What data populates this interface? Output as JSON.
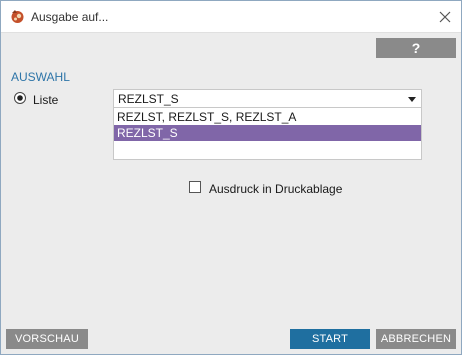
{
  "window": {
    "title": "Ausgabe auf..."
  },
  "toolbar": {
    "help_label": "?"
  },
  "selection": {
    "section_label": "AUSWAHL",
    "radio_label": "Liste",
    "radio_checked": true,
    "select": {
      "value": "REZLST_S",
      "options": [
        "REZLST, REZLST_S, REZLST_A",
        "REZLST_S"
      ],
      "highlighted_index": 1
    }
  },
  "options": {
    "print_tray_label": "Ausdruck in Druckablage",
    "print_tray_checked": false
  },
  "footer": {
    "preview_label": "VORSCHAU",
    "start_label": "START",
    "cancel_label": "ABBRECHEN"
  },
  "colors": {
    "accent_blue": "#1f6fa0",
    "section_label": "#2e75a8",
    "selected_item": "#8066a8",
    "gray_button": "#8a8a8a"
  },
  "icons": {
    "app": "app-icon",
    "close": "close-icon",
    "dropdown": "chevron-down-icon"
  }
}
